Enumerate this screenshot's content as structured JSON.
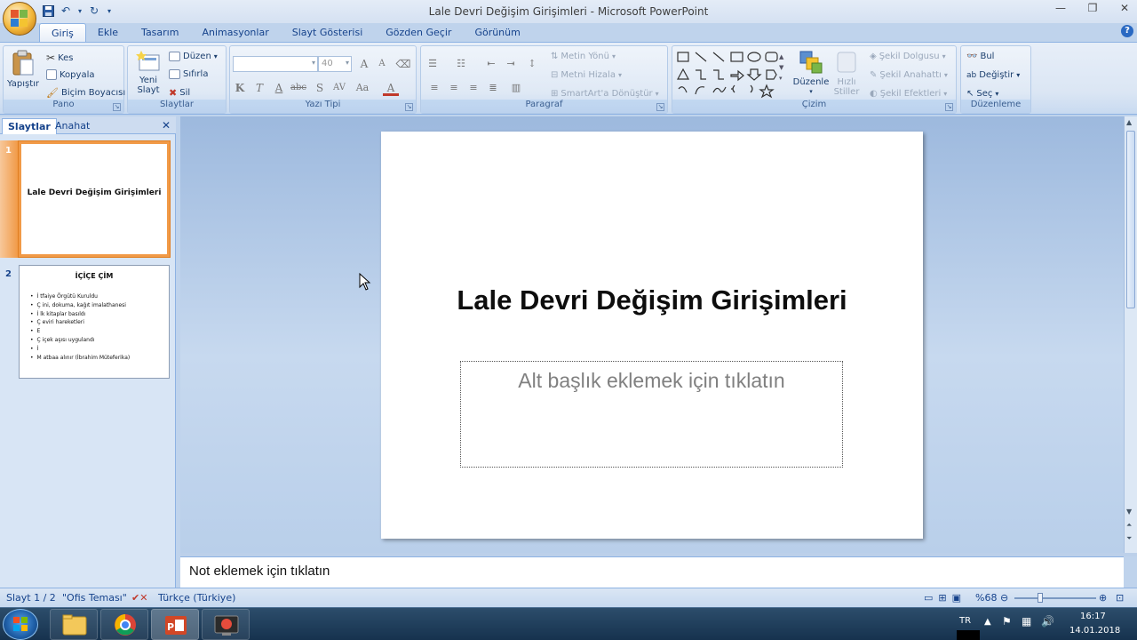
{
  "window": {
    "title": "Lale Devri Değişim Girişimleri - Microsoft PowerPoint"
  },
  "ribbon_tabs": [
    "Giriş",
    "Ekle",
    "Tasarım",
    "Animasyonlar",
    "Slayt Gösterisi",
    "Gözden Geçir",
    "Görünüm"
  ],
  "ribbon": {
    "pano": {
      "label": "Pano",
      "paste": "Yapıştır",
      "cut": "Kes",
      "copy": "Kopyala",
      "format_painter": "Biçim Boyacısı"
    },
    "slaytlar": {
      "label": "Slaytlar",
      "new_slide": "Yeni Slayt",
      "layout": "Düzen",
      "reset": "Sıfırla",
      "delete": "Sil"
    },
    "yazi_tipi": {
      "label": "Yazı Tipi",
      "font_name": "",
      "font_size": "40"
    },
    "paragraf": {
      "label": "Paragraf",
      "text_direction": "Metin Yönü",
      "align_text": "Metni Hizala",
      "smartart": "SmartArt'a Dönüştür"
    },
    "cizim": {
      "label": "Çizim",
      "arrange": "Düzenle",
      "quick_styles": "Hızlı Stiller",
      "shape_fill": "Şekil Dolgusu",
      "shape_outline": "Şekil Anahattı",
      "shape_effects": "Şekil Efektleri"
    },
    "duzenleme": {
      "label": "Düzenleme",
      "find": "Bul",
      "replace": "Değiştir",
      "select": "Seç"
    }
  },
  "side_panel": {
    "tabs": [
      "Slaytlar",
      "Anahat"
    ],
    "slides": [
      {
        "number": "1",
        "title": "Lale Devri Değişim Girişimleri"
      },
      {
        "number": "2",
        "title": "İÇİÇE ÇİM",
        "bullets": [
          "İ tfaiye Örgütü Kuruldu",
          "Ç ini, dokuma, kağıt imalathanesi",
          "İ lk kitaplar basıldı",
          "Ç eviri hareketleri",
          "E",
          "Ç içek aşısı uygulandı",
          "İ",
          "M atbaa alınır (İbrahim Müteferika)"
        ]
      }
    ]
  },
  "slide": {
    "title": "Lale Devri Değişim Girişimleri",
    "subtitle_placeholder": "Alt başlık eklemek için tıklatın"
  },
  "notes_placeholder": "Not eklemek için tıklatın",
  "status": {
    "slide_counter": "Slayt 1 / 2",
    "theme": "\"Ofis Teması\"",
    "language": "Türkçe (Türkiye)",
    "zoom": "%68"
  },
  "taskbar": {
    "language": "TR",
    "time": "16:17",
    "date": "14.01.2018"
  },
  "colors": {
    "ribbon_text": "#15428b",
    "selection_orange": "#f19a47",
    "canvas_blue": "#b9cfea"
  }
}
